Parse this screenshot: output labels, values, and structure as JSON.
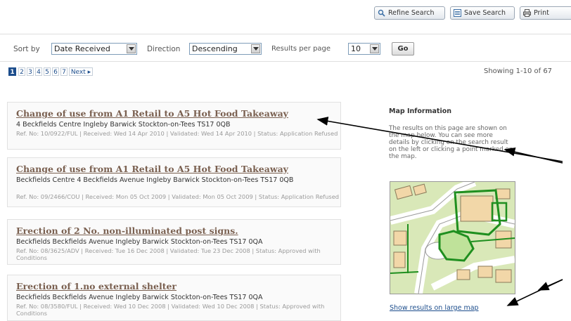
{
  "toolbar": {
    "refine_label": "Refine Search",
    "save_label": "Save Search",
    "print_label": "Print"
  },
  "sortbar": {
    "sort_by_label": "Sort by",
    "sort_by_value": "Date Received",
    "direction_label": "Direction",
    "direction_value": "Descending",
    "per_page_label": "Results per page",
    "per_page_value": "10",
    "go_label": "Go"
  },
  "pagination": {
    "pages": [
      "1",
      "2",
      "3",
      "4",
      "5",
      "6",
      "7"
    ],
    "current": "1",
    "next_label": "Next ▸",
    "showing": "Showing 1-10 of 67"
  },
  "results": [
    {
      "title": "Change of use from A1 Retail to A5 Hot Food Takeaway",
      "address": "4 Beckfields Centre Ingleby Barwick Stockton-on-Tees TS17 0QB",
      "meta": "Ref. No: 10/0922/FUL | Received: Wed 14 Apr 2010 | Validated: Wed 14 Apr 2010 | Status: Application Refused"
    },
    {
      "title": "Change of use from A1 Retail to A5 Hot Food Takeaway",
      "address": "Beckfields Centre 4 Beckfields Avenue Ingleby Barwick Stockton-on-Tees TS17 0QB",
      "meta": "Ref. No: 09/2466/COU | Received: Mon 05 Oct 2009 | Validated: Mon 05 Oct 2009 | Status: Application Refused"
    },
    {
      "title": "Erection of 2 No. non-illuminated post signs.",
      "address": "Beckfields Beckfields Avenue Ingleby Barwick Stockton-on-Tees TS17 0QA",
      "meta": "Ref. No: 08/3625/ADV | Received: Tue 16 Dec 2008 | Validated: Tue 23 Dec 2008 | Status: Approved with Conditions"
    },
    {
      "title": "Erection of 1.no external shelter",
      "address": "Beckfields Beckfields Avenue Ingleby Barwick Stockton-on-Tees TS17 0QA",
      "meta": "Ref. No: 08/3580/FUL | Received: Wed 10 Dec 2008 | Validated: Wed 10 Dec 2008 | Status: Approved with Conditions"
    }
  ],
  "map_info": {
    "heading": "Map Information",
    "text": "The results on this page are shown on the map below. You can see more details by clicking on the search result on the left or clicking a point marked on the map.",
    "large_map_link": "Show results on large map"
  },
  "icons": {
    "refine": "magnifier-icon",
    "save": "save-list-icon",
    "print": "printer-icon"
  },
  "colors": {
    "link_blue": "#1c4d8c",
    "title_brown": "#7a6050",
    "map_green": "#1f8f1f"
  }
}
